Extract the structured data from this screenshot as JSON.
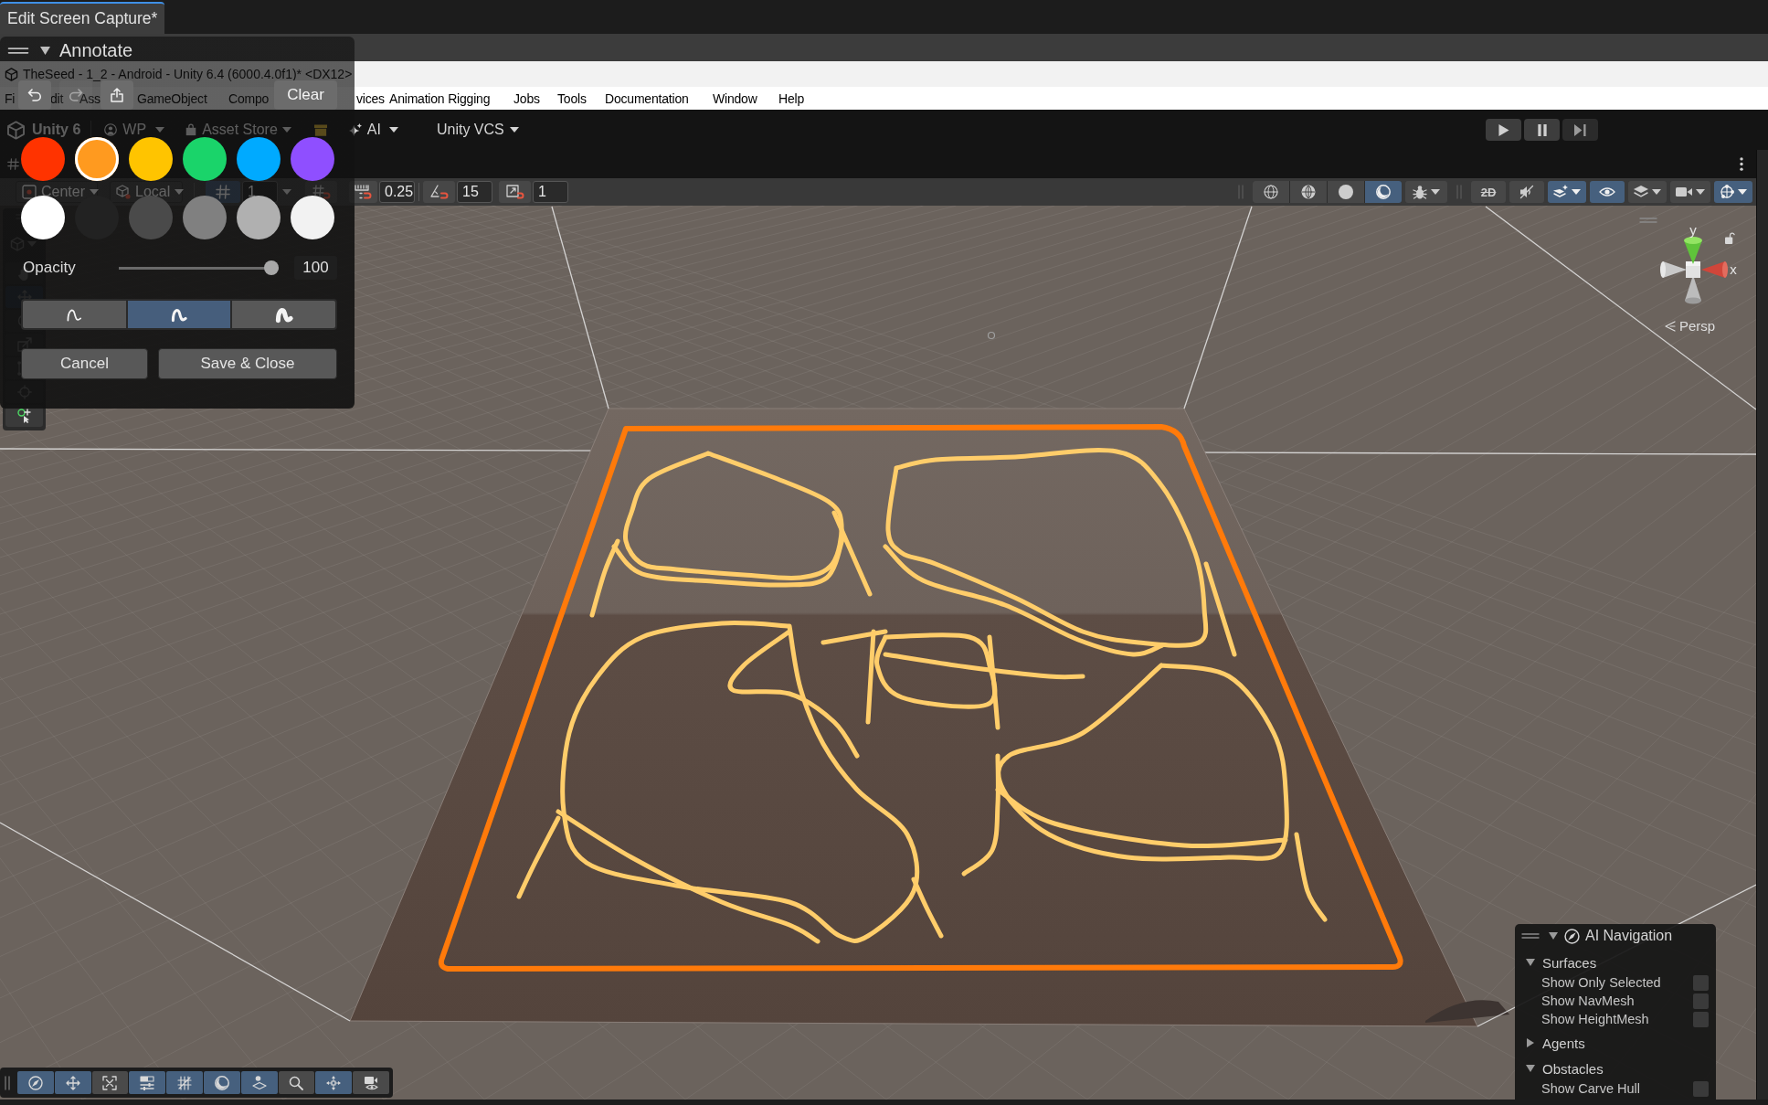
{
  "editor_tab": {
    "title": "Edit Screen Capture*",
    "selected": true
  },
  "window": {
    "title": "TheSeed - 1_2 - Android - Unity 6.4 (6000.4.0f1)* <DX12>"
  },
  "menu_bar": [
    "Fi",
    "dit",
    "Ass",
    "GameObject",
    "Compo",
    "vices",
    "Animation Rigging",
    "Jobs",
    "Tools",
    "Documentation",
    "Window",
    "Help"
  ],
  "main_toolbar": [
    {
      "kind": "product",
      "label": "Unity 6"
    },
    {
      "kind": "account",
      "label": "WP"
    },
    {
      "kind": "store",
      "label": "Asset Store"
    },
    {
      "kind": "package"
    },
    {
      "kind": "ai",
      "label": "AI"
    },
    {
      "kind": "vcs",
      "label": "Unity VCS"
    }
  ],
  "scene_toolbar": {
    "pivot": "Center",
    "space": "Local",
    "grid_snap": {
      "on": true,
      "value": "1"
    },
    "snap": {
      "on": false
    },
    "move_snap": "0.25",
    "rotate_snap": "15",
    "scale_snap": "1",
    "shading_modes": [
      {
        "kind": "wireframe",
        "selected": false
      },
      {
        "kind": "shaded-wireframe",
        "selected": false
      },
      {
        "kind": "shaded",
        "selected": false
      },
      {
        "kind": "unlit",
        "selected": true
      }
    ],
    "view_toggles": [
      {
        "kind": "dimension",
        "label": "2D",
        "on": false
      },
      {
        "kind": "audio",
        "on": false
      },
      {
        "kind": "effects",
        "on": true
      },
      {
        "kind": "visibility",
        "on": true
      },
      {
        "kind": "layers",
        "on": false
      },
      {
        "kind": "camera",
        "on": false
      },
      {
        "kind": "gizmos",
        "on": true
      }
    ]
  },
  "tools": [
    {
      "kind": "view",
      "selected": false
    },
    {
      "kind": "move",
      "selected": true
    },
    {
      "kind": "rotate",
      "selected": false
    },
    {
      "kind": "scale",
      "selected": false
    },
    {
      "kind": "rect",
      "selected": false
    },
    {
      "kind": "transform",
      "selected": false
    },
    {
      "kind": "custom",
      "selected": false
    }
  ],
  "annotate_panel": {
    "title": "Annotate",
    "expanded": true,
    "actions": [
      {
        "kind": "undo",
        "disabled": false
      },
      {
        "kind": "redo",
        "disabled": true
      },
      {
        "kind": "share",
        "disabled": false
      }
    ],
    "clear_label": "Clear",
    "swatches": [
      {
        "color": "#ff3300",
        "selected": false
      },
      {
        "color": "#ff9a1f",
        "selected": true
      },
      {
        "color": "#ffc400",
        "selected": false
      },
      {
        "color": "#1ad46a",
        "selected": false
      },
      {
        "color": "#00aaff",
        "selected": false
      },
      {
        "color": "#8f4fff",
        "selected": false
      },
      {
        "color": "#ffffff",
        "selected": false
      },
      {
        "color": "#222222",
        "selected": false
      },
      {
        "color": "#4a4a4a",
        "selected": false
      },
      {
        "color": "#808080",
        "selected": false
      },
      {
        "color": "#b0b0b0",
        "selected": false
      },
      {
        "color": "#f2f2f2",
        "selected": false
      }
    ],
    "opacity": {
      "label": "Opacity",
      "level": 1,
      "value": "100"
    },
    "brush_sizes": [
      {
        "kind": "thin",
        "selected": false
      },
      {
        "kind": "medium",
        "selected": true
      },
      {
        "kind": "thick",
        "selected": false
      }
    ],
    "buttons": [
      {
        "kind": "cancel",
        "label": "Cancel"
      },
      {
        "kind": "save",
        "label": "Save & Close"
      }
    ]
  },
  "scene_view": {
    "orientation_gizmo": {
      "y_label": "y",
      "x_label": "x",
      "locked": false
    },
    "projection": "Persp"
  },
  "ai_navigation": {
    "title": "AI Navigation",
    "expanded": true,
    "sections": [
      {
        "title": "Surfaces",
        "expanded": true,
        "options": [
          {
            "label": "Show Only Selected",
            "checked": false
          },
          {
            "label": "Show NavMesh",
            "checked": false
          },
          {
            "label": "Show HeightMesh",
            "checked": false
          }
        ]
      },
      {
        "title": "Agents",
        "expanded": false
      },
      {
        "title": "Obstacles",
        "expanded": true,
        "options": [
          {
            "label": "Show Carve Hull",
            "checked": false
          }
        ]
      }
    ]
  },
  "overlay_toolbar": [
    {
      "kind": "navigation",
      "on": true
    },
    {
      "kind": "move",
      "on": true
    },
    {
      "kind": "xray",
      "on": false
    },
    {
      "kind": "settings",
      "on": true
    },
    {
      "kind": "grid",
      "on": true
    },
    {
      "kind": "lighting",
      "on": true
    },
    {
      "kind": "probe",
      "on": true
    },
    {
      "kind": "search",
      "on": false
    },
    {
      "kind": "nodes",
      "on": true
    },
    {
      "kind": "camera",
      "on": false
    }
  ]
}
